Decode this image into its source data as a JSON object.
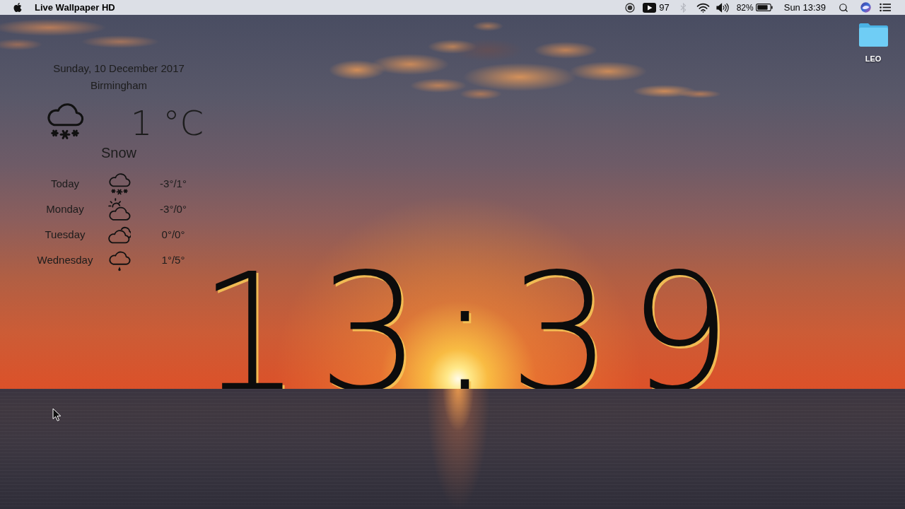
{
  "menu_bar": {
    "app_name": "Live Wallpaper HD",
    "video_count": "97",
    "bluetooth": {
      "on": false
    },
    "battery_percent": "82%",
    "datetime": "Sun 13:39"
  },
  "weather": {
    "date": "Sunday, 10 December 2017",
    "city": "Birmingham",
    "current": {
      "kind": "snow",
      "temperature": "1 °C",
      "condition": "Snow"
    },
    "forecast": [
      {
        "day": "Today",
        "kind": "snow",
        "range": "-3°/1°"
      },
      {
        "day": "Monday",
        "kind": "partly_sunny",
        "range": "-3°/0°"
      },
      {
        "day": "Tuesday",
        "kind": "cloudy",
        "range": "0°/0°"
      },
      {
        "day": "Wednesday",
        "kind": "rain",
        "range": "1°/5°"
      }
    ]
  },
  "clock": {
    "time": "13:39"
  },
  "desktop": {
    "folders": [
      {
        "label": "LEO"
      }
    ]
  }
}
